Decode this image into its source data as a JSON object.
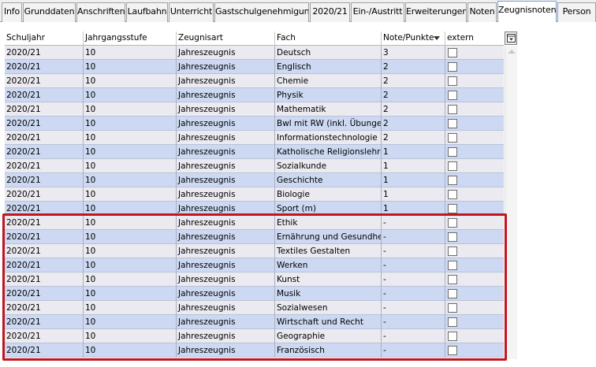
{
  "tabs": [
    {
      "label": "Info"
    },
    {
      "label": "Grunddaten"
    },
    {
      "label": "Anschriften"
    },
    {
      "label": "Laufbahn"
    },
    {
      "label": "Unterricht"
    },
    {
      "label": "Gastschulgenehmigung"
    },
    {
      "label": "2020/21"
    },
    {
      "label": "Ein-/Austritt"
    },
    {
      "label": "Erweiterungen"
    },
    {
      "label": "Noten"
    },
    {
      "label": "Zeugnisnoten"
    },
    {
      "label": "Person"
    }
  ],
  "active_tab": "Zeugnisnoten",
  "table": {
    "headers": [
      "Schuljahr",
      "Jahrgangsstufe",
      "Zeugnisart",
      "Fach",
      "Note/Punkte",
      "extern"
    ],
    "sorted_column": "Note/Punkte",
    "rows": [
      {
        "schuljahr": "2020/21",
        "stufe": "10",
        "art": "Jahreszeugnis",
        "fach": "Deutsch",
        "note": "3",
        "extern": false
      },
      {
        "schuljahr": "2020/21",
        "stufe": "10",
        "art": "Jahreszeugnis",
        "fach": "Englisch",
        "note": "2",
        "extern": false
      },
      {
        "schuljahr": "2020/21",
        "stufe": "10",
        "art": "Jahreszeugnis",
        "fach": "Chemie",
        "note": "2",
        "extern": false
      },
      {
        "schuljahr": "2020/21",
        "stufe": "10",
        "art": "Jahreszeugnis",
        "fach": "Physik",
        "note": "2",
        "extern": false
      },
      {
        "schuljahr": "2020/21",
        "stufe": "10",
        "art": "Jahreszeugnis",
        "fach": "Mathematik",
        "note": "2",
        "extern": false
      },
      {
        "schuljahr": "2020/21",
        "stufe": "10",
        "art": "Jahreszeugnis",
        "fach": "Bwl mit RW (inkl. Übungen)",
        "note": "2",
        "extern": false
      },
      {
        "schuljahr": "2020/21",
        "stufe": "10",
        "art": "Jahreszeugnis",
        "fach": "Informationstechnologie",
        "note": "2",
        "extern": false
      },
      {
        "schuljahr": "2020/21",
        "stufe": "10",
        "art": "Jahreszeugnis",
        "fach": "Katholische Religionslehre",
        "note": "1",
        "extern": false
      },
      {
        "schuljahr": "2020/21",
        "stufe": "10",
        "art": "Jahreszeugnis",
        "fach": "Sozialkunde",
        "note": "1",
        "extern": false
      },
      {
        "schuljahr": "2020/21",
        "stufe": "10",
        "art": "Jahreszeugnis",
        "fach": "Geschichte",
        "note": "1",
        "extern": false
      },
      {
        "schuljahr": "2020/21",
        "stufe": "10",
        "art": "Jahreszeugnis",
        "fach": "Biologie",
        "note": "1",
        "extern": false
      },
      {
        "schuljahr": "2020/21",
        "stufe": "10",
        "art": "Jahreszeugnis",
        "fach": "Sport (m)",
        "note": "1",
        "extern": false
      },
      {
        "schuljahr": "2020/21",
        "stufe": "10",
        "art": "Jahreszeugnis",
        "fach": "Ethik",
        "note": "-",
        "extern": false
      },
      {
        "schuljahr": "2020/21",
        "stufe": "10",
        "art": "Jahreszeugnis",
        "fach": "Ernährung und Gesundheit",
        "note": "-",
        "extern": false
      },
      {
        "schuljahr": "2020/21",
        "stufe": "10",
        "art": "Jahreszeugnis",
        "fach": "Textiles Gestalten",
        "note": "-",
        "extern": false
      },
      {
        "schuljahr": "2020/21",
        "stufe": "10",
        "art": "Jahreszeugnis",
        "fach": "Werken",
        "note": "-",
        "extern": false
      },
      {
        "schuljahr": "2020/21",
        "stufe": "10",
        "art": "Jahreszeugnis",
        "fach": "Kunst",
        "note": "-",
        "extern": false
      },
      {
        "schuljahr": "2020/21",
        "stufe": "10",
        "art": "Jahreszeugnis",
        "fach": "Musik",
        "note": "-",
        "extern": false
      },
      {
        "schuljahr": "2020/21",
        "stufe": "10",
        "art": "Jahreszeugnis",
        "fach": "Sozialwesen",
        "note": "-",
        "extern": false
      },
      {
        "schuljahr": "2020/21",
        "stufe": "10",
        "art": "Jahreszeugnis",
        "fach": "Wirtschaft und Recht",
        "note": "-",
        "extern": false
      },
      {
        "schuljahr": "2020/21",
        "stufe": "10",
        "art": "Jahreszeugnis",
        "fach": "Geographie",
        "note": "-",
        "extern": false
      },
      {
        "schuljahr": "2020/21",
        "stufe": "10",
        "art": "Jahreszeugnis",
        "fach": "Französisch",
        "note": "-",
        "extern": false
      }
    ]
  },
  "colors": {
    "highlight": "#c0161f",
    "row_odd": "#eaeaf0",
    "row_even": "#cdd9f2"
  },
  "icons": {
    "column-chooser": "column-chooser-icon",
    "sort": "sort-desc-icon"
  }
}
